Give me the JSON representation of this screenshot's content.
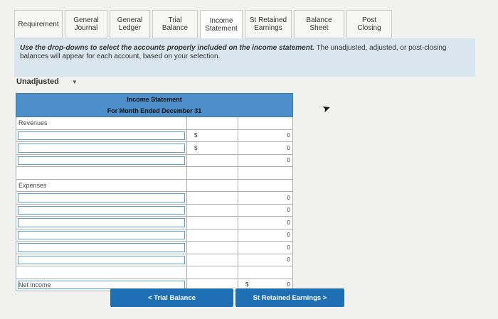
{
  "tabs": [
    {
      "label": "Requirement",
      "width": 68
    },
    {
      "label": "General\nJournal",
      "width": 60
    },
    {
      "label": "General\nLedger",
      "width": 57
    },
    {
      "label": "Trial Balance",
      "width": 64
    },
    {
      "label": "Income\nStatement",
      "width": 60,
      "active": true
    },
    {
      "label": "St Retained\nEarnings",
      "width": 66
    },
    {
      "label": "Balance Sheet",
      "width": 71
    },
    {
      "label": "Post Closing",
      "width": 64
    }
  ],
  "info": {
    "bold": "Use the drop-downs to select the accounts properly included on the income statement.",
    "rest": " The unadjusted, adjusted, or post-closing balances will appear for each account, based on your selection."
  },
  "dropdown": {
    "value": "Unadjusted"
  },
  "statement": {
    "title": "Income Statement",
    "subtitle": "For Month Ended December 31",
    "revenues_label": "Revenues",
    "expenses_label": "Expenses",
    "net_income_label": "Net income",
    "revenue_rows": [
      {
        "dollar": "$",
        "value": "0"
      },
      {
        "dollar": "$",
        "value": "0"
      },
      {
        "dollar": "",
        "value": "0",
        "total": true
      }
    ],
    "expense_rows": [
      {
        "value": "0"
      },
      {
        "value": "0"
      },
      {
        "value": "0"
      },
      {
        "value": "0"
      },
      {
        "value": "0"
      },
      {
        "value": "0"
      }
    ],
    "net_income": {
      "dollar": "$",
      "value": "0"
    }
  },
  "buttons": {
    "prev": "< Trial Balance",
    "next": "St Retained Earnings >"
  }
}
